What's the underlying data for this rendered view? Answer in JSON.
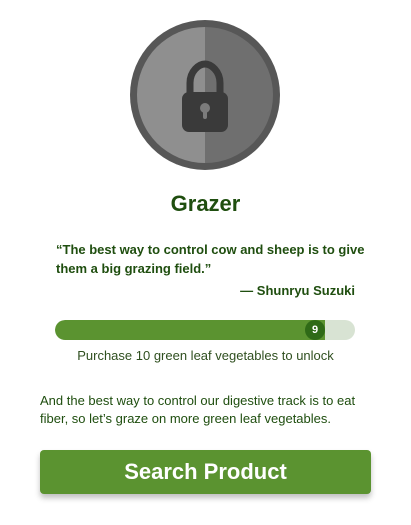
{
  "badge": {
    "icon": "lock-icon",
    "colors": {
      "ring": "#575757",
      "left": "#8f8f8f",
      "right": "#6f6f6f",
      "lock": "#3a3a3a"
    }
  },
  "title": "Grazer",
  "quote": {
    "text": "“The best way to control cow and sheep is to give them a big grazing field.”",
    "author": "— Shunryu Suzuki"
  },
  "progress": {
    "current": 9,
    "target": 10,
    "knob_label": "9",
    "label": "Purchase 10 green leaf vegetables to unlock",
    "colors": {
      "fill": "#5b9330",
      "track": "#d8e3d3",
      "knob": "#2f6a17"
    }
  },
  "description": "And the best way to control our digestive track is to eat fiber, so let’s graze on more green leaf vegetables.",
  "cta": {
    "label": "Search Product",
    "color": "#5b9330"
  }
}
